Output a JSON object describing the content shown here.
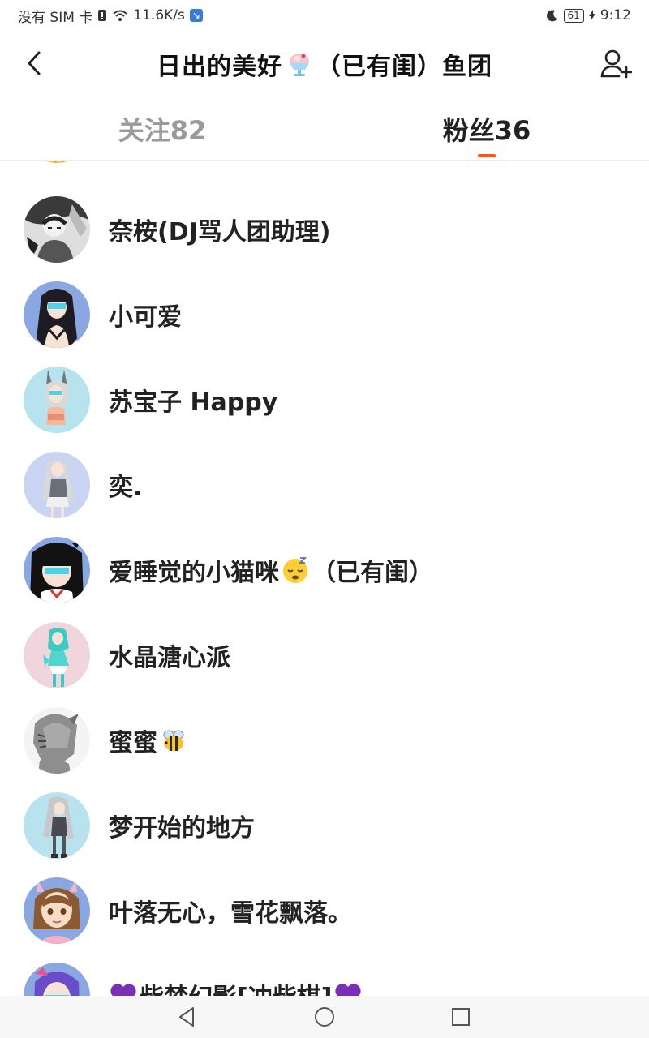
{
  "status_bar": {
    "carrier": "没有 SIM 卡",
    "speed": "11.6K/s",
    "battery": "61",
    "time": "9:12"
  },
  "header": {
    "title_prefix": "日出的美好",
    "title_suffix": "（已有闺）鱼团",
    "back_icon": "chevron-left-icon",
    "add_icon": "add-user-icon"
  },
  "tabs": {
    "following": "关注82",
    "fans": "粉丝36",
    "active": "fans",
    "accent": "#f05a1a"
  },
  "fans": [
    {
      "name": "奈桉(DJ骂人团助理)"
    },
    {
      "name": "小可爱"
    },
    {
      "name": "苏宝子 Happy"
    },
    {
      "name": "奕."
    },
    {
      "name_prefix": "爱睡觉的小猫咪",
      "name_suffix": "（已有闺）"
    },
    {
      "name": "水晶溏心派"
    },
    {
      "name": "蜜蜜"
    },
    {
      "name": "梦开始的地方"
    },
    {
      "name": "叶落无心，雪花飘落。"
    },
    {
      "name": "柴梦幻影[冲柴棋]"
    }
  ]
}
